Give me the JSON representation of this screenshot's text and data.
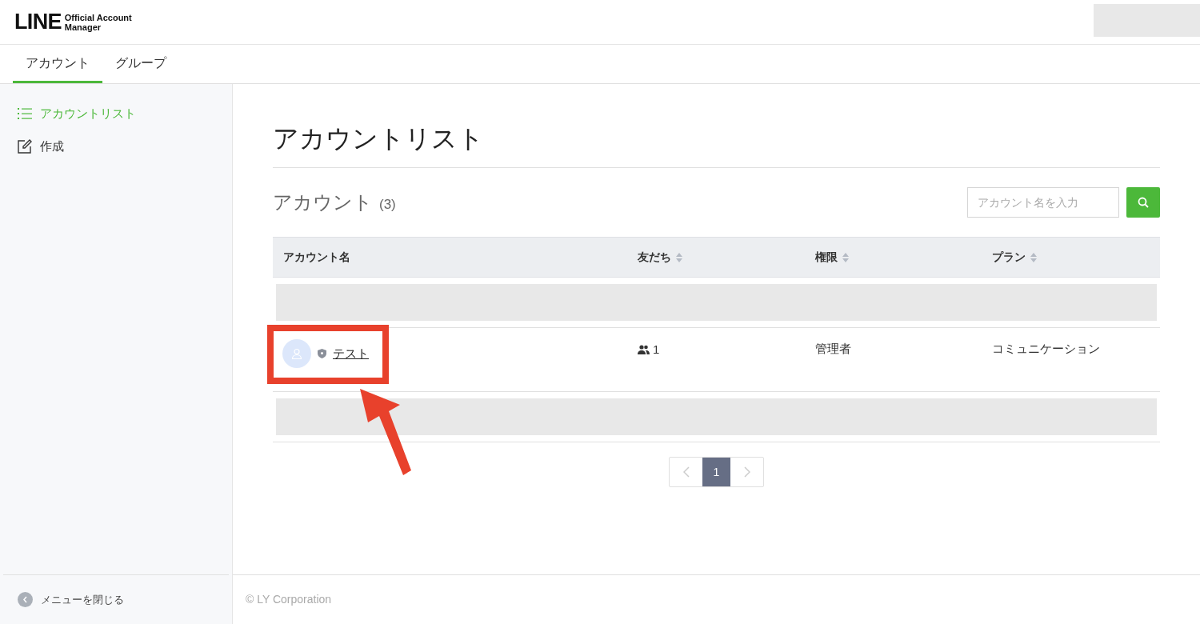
{
  "logo": {
    "wordmark": "LINE",
    "line1": "Official Account",
    "line2": "Manager"
  },
  "tabs": [
    {
      "label": "アカウント",
      "selected": true
    },
    {
      "label": "グループ",
      "selected": false
    }
  ],
  "sidebar": {
    "items": [
      {
        "label": "アカウントリスト",
        "kind": "list",
        "selected": true
      },
      {
        "label": "作成",
        "kind": "edit",
        "selected": false
      }
    ],
    "close_menu": "メニューを閉じる"
  },
  "page_title": "アカウントリスト",
  "section": {
    "title": "アカウント",
    "count": "(3)"
  },
  "search": {
    "placeholder": "アカウント名を入力"
  },
  "table": {
    "columns": [
      {
        "label": "アカウント名",
        "sortable": false
      },
      {
        "label": "友だち",
        "sortable": true
      },
      {
        "label": "権限",
        "sortable": true
      },
      {
        "label": "プラン",
        "sortable": true
      }
    ],
    "rows": [
      {
        "kind": "redacted"
      },
      {
        "kind": "account",
        "name": "テスト",
        "friends": "1",
        "role": "管理者",
        "plan": "コミュニケーション",
        "highlighted": true
      },
      {
        "kind": "redacted"
      }
    ]
  },
  "pagination": {
    "pages": [
      {
        "label": "1",
        "selected": true
      }
    ]
  },
  "footer": "© LY Corporation"
}
